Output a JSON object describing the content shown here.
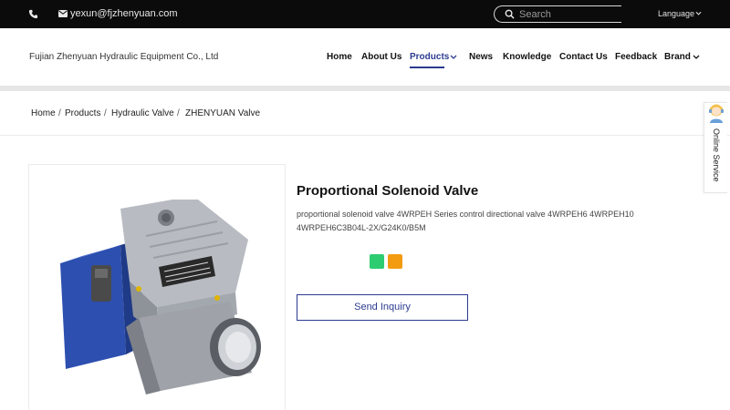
{
  "topbar": {
    "phone_icon": "phone-icon",
    "mail_icon": "mail-icon",
    "email": "yexun@fjzhenyuan.com",
    "search_placeholder": "Search",
    "language_label": "Language"
  },
  "header": {
    "company_name": "Fujian Zhenyuan Hydraulic Equipment Co., Ltd",
    "nav": [
      {
        "label": "Home"
      },
      {
        "label": "About Us"
      },
      {
        "label": "Products"
      },
      {
        "label": "News"
      },
      {
        "label": "Knowledge"
      },
      {
        "label": "Contact Us"
      },
      {
        "label": "Feedback"
      },
      {
        "label": "Brand"
      }
    ],
    "active_nav": "Products",
    "accent_color": "#2b3b8f"
  },
  "breadcrumb": {
    "items": [
      "Home",
      "Products",
      "Hydraulic Valve",
      "ZHENYUAN Valve"
    ],
    "separator": "/"
  },
  "product": {
    "title": "Proportional Solenoid Valve",
    "description": "proportional solenoid valve 4WRPEH Series control directional valve 4WRPEH6 4WRPEH10 4WRPEH6C3B04L-2X/G24K0/B5M",
    "share_colors": [
      "#2ecc71",
      "#f39c12"
    ],
    "inquiry_label": "Send Inquiry",
    "image_icon": "hydraulic-valve-image"
  },
  "service": {
    "label": "Online Service",
    "avatar_icon": "support-avatar-icon"
  }
}
